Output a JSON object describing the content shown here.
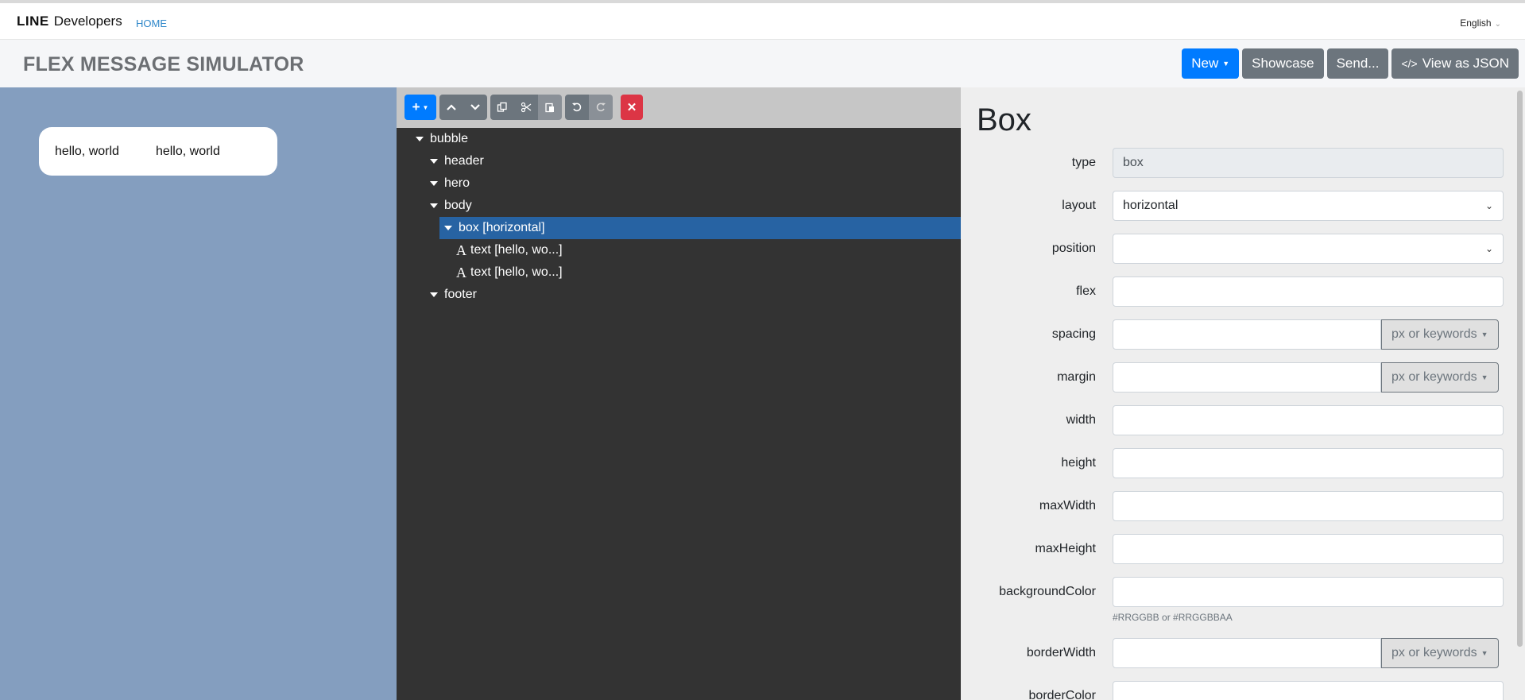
{
  "nav": {
    "brand_line": "LINE",
    "brand_developers": "Developers",
    "home": "HOME",
    "language": "English"
  },
  "header": {
    "title": "FLEX MESSAGE SIMULATOR",
    "buttons": {
      "new": "New",
      "showcase": "Showcase",
      "send": "Send...",
      "view_json": "View as JSON"
    }
  },
  "preview": {
    "texts": [
      "hello, world",
      "hello, world"
    ]
  },
  "toolbar": {
    "icons": [
      "plus-icon",
      "arrow-up-icon",
      "arrow-down-icon",
      "copy-icon",
      "cut-icon",
      "paste-icon",
      "undo-icon",
      "redo-icon",
      "delete-icon"
    ]
  },
  "tree": {
    "nodes": [
      {
        "label": "bubble"
      },
      {
        "label": "header"
      },
      {
        "label": "hero"
      },
      {
        "label": "body"
      },
      {
        "label": "box [horizontal]",
        "selected": true
      },
      {
        "label": "text [hello, wo...]"
      },
      {
        "label": "text [hello, wo...]"
      },
      {
        "label": "footer"
      }
    ]
  },
  "props": {
    "title": "Box",
    "fields": {
      "type": {
        "label": "type",
        "value": "box"
      },
      "layout": {
        "label": "layout",
        "value": "horizontal"
      },
      "position": {
        "label": "position",
        "value": ""
      },
      "flex": {
        "label": "flex",
        "value": ""
      },
      "spacing": {
        "label": "spacing",
        "value": "",
        "addon": "px or keywords"
      },
      "margin": {
        "label": "margin",
        "value": "",
        "addon": "px or keywords"
      },
      "width": {
        "label": "width",
        "value": ""
      },
      "height": {
        "label": "height",
        "value": ""
      },
      "maxWidth": {
        "label": "maxWidth",
        "value": ""
      },
      "maxHeight": {
        "label": "maxHeight",
        "value": ""
      },
      "backgroundColor": {
        "label": "backgroundColor",
        "value": "",
        "hint": "#RRGGBB or #RRGGBBAA"
      },
      "borderWidth": {
        "label": "borderWidth",
        "value": "",
        "addon": "px or keywords"
      },
      "borderColor": {
        "label": "borderColor",
        "value": ""
      }
    }
  },
  "colors": {
    "primary": "#007bff",
    "secondary": "#6c757d",
    "danger": "#dc3545",
    "preview_bg": "#849ebf",
    "tree_bg": "#333333",
    "selected": "#2763a3"
  }
}
